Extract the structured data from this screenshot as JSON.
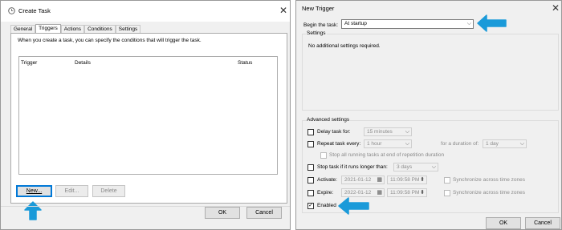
{
  "create_task": {
    "title": "Create Task",
    "tabs": [
      "General",
      "Triggers",
      "Actions",
      "Conditions",
      "Settings"
    ],
    "description": "When you create a task, you can specify the conditions that will trigger the task.",
    "columns": [
      "Trigger",
      "Details",
      "Status"
    ],
    "buttons": {
      "new": "New...",
      "edit": "Edit...",
      "delete": "Delete"
    },
    "ok": "OK",
    "cancel": "Cancel"
  },
  "new_trigger": {
    "title": "New Trigger",
    "begin_label": "Begin the task:",
    "begin_value": "At startup",
    "settings_label": "Settings",
    "settings_text": "No additional settings required.",
    "advanced_label": "Advanced settings",
    "delay_label": "Delay task for:",
    "delay_value": "15 minutes",
    "repeat_label": "Repeat task every:",
    "repeat_value": "1 hour",
    "duration_label": "for a duration of:",
    "duration_value": "1 day",
    "stop_running_label": "Stop all running tasks at end of repetition duration",
    "stop_longer_label": "Stop task if it runs longer than:",
    "stop_longer_value": "3 days",
    "activate_label": "Activate:",
    "activate_date": "2021-01-12",
    "activate_time": "11:09:58 PM",
    "expire_label": "Expire:",
    "expire_date": "2022-01-12",
    "expire_time": "11:09:58 PM",
    "sync_label": "Synchronize across time zones",
    "enabled_label": "Enabled",
    "ok": "OK",
    "cancel": "Cancel"
  },
  "colors": {
    "arrow": "#1a9ad9",
    "accent": "#0078d7"
  }
}
